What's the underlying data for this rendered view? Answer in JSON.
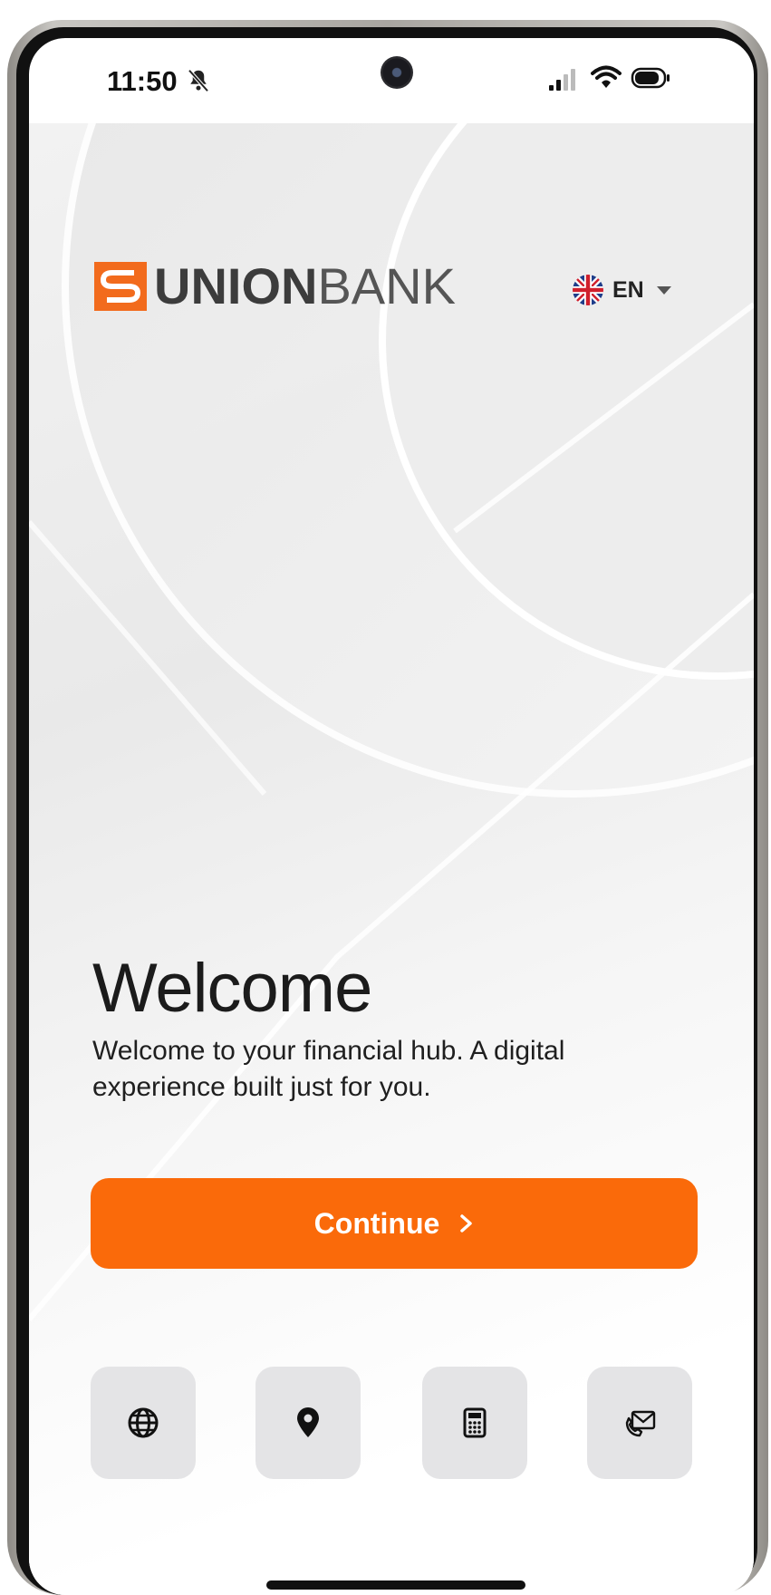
{
  "status_bar": {
    "time": "11:50",
    "icons": [
      "bell-slash-icon",
      "signal-icon",
      "wifi-icon",
      "battery-icon"
    ]
  },
  "header": {
    "logo_strong": "UNION",
    "logo_light": "BANK",
    "language": {
      "code": "EN",
      "flag_icon": "uk-flag-icon"
    }
  },
  "welcome": {
    "title": "Welcome",
    "description": "Welcome to your financial hub. A digital experience built just for you."
  },
  "continue_button": {
    "label": "Continue",
    "icon": "chevron-right-icon"
  },
  "quick_actions": [
    {
      "icon": "globe-icon"
    },
    {
      "icon": "location-pin-icon"
    },
    {
      "icon": "calculator-icon"
    },
    {
      "icon": "mail-icon"
    }
  ],
  "colors": {
    "accent": "#fa6a0a",
    "tile_background": "#e4e4e6",
    "text": "#1b1b1b"
  }
}
